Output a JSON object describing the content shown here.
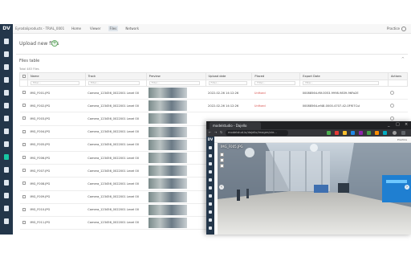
{
  "app": {
    "logo": "DV",
    "project": "Eyrodaliproducts - TRIAL_0001",
    "tabs": [
      "Home",
      "Viewer",
      "Files",
      "Network"
    ],
    "active_tab": "Files",
    "user": "Practice"
  },
  "upload": {
    "label": "Upload new files",
    "add_symbol": "+"
  },
  "files": {
    "title": "Files table",
    "collapse_symbol": "^",
    "count": "Total 483 Files",
    "columns": [
      "Name",
      "Track",
      "Preview",
      "Upload date",
      "Placed",
      "Export Date",
      "Actions"
    ],
    "filter_placeholder": "Filter...",
    "rows": [
      {
        "name": "IMG_F001.JPG",
        "track": "Camera_123456_0022001 Level 00",
        "upload": "2022-02-26 14:12:26",
        "placed": "Unfixed",
        "export": "00088564-f6f-0053-9998-9839-96Fa2E"
      },
      {
        "name": "IMG_F002.JPG",
        "track": "Camera_123456_0022001 Level 00",
        "upload": "2022-02-26 14:12:26",
        "placed": "Unfixed",
        "export": "00088564-ef48-0000-4707-42-0Ff07Cul"
      },
      {
        "name": "IMG_F003.JPG",
        "track": "Camera_123456_0022001 Level 00",
        "upload": "",
        "placed": "",
        "export": ""
      },
      {
        "name": "IMG_F004.JPG",
        "track": "Camera_123456_0022001 Level 00",
        "upload": "",
        "placed": "",
        "export": ""
      },
      {
        "name": "IMG_F005.JPG",
        "track": "Camera_123456_0022001 Level 00",
        "upload": "",
        "placed": "",
        "export": ""
      },
      {
        "name": "IMG_F006.JPG",
        "track": "Camera_123456_0022001 Level 00",
        "upload": "",
        "placed": "",
        "export": ""
      },
      {
        "name": "IMG_F007.JPG",
        "track": "Camera_123456_0022001 Level 00",
        "upload": "",
        "placed": "",
        "export": ""
      },
      {
        "name": "IMG_F008.JPG",
        "track": "Camera_123456_0022001 Level 00",
        "upload": "",
        "placed": "",
        "export": ""
      },
      {
        "name": "IMG_F009.JPG",
        "track": "Camera_123456_0022001 Level 00",
        "upload": "",
        "placed": "",
        "export": ""
      },
      {
        "name": "IMG_F010.JPG",
        "track": "Camera_123456_0022001 Level 00",
        "upload": "",
        "placed": "",
        "export": ""
      },
      {
        "name": "IMG_F011.JPG",
        "track": "Camera_123456_0022001 Level 00",
        "upload": "",
        "placed": "",
        "export": ""
      }
    ]
  },
  "preview_window": {
    "tab_title": "modelstudio - Dajello",
    "url": "modelstud.io/dajello/images/vie...",
    "image_title": "IMG_F005.JPG",
    "controls": [
      "_",
      "□",
      "×"
    ],
    "nav_prev": "‹",
    "nav_next": "›"
  },
  "colors": {
    "sidebar": "#23364a",
    "accent": "#18c6a3",
    "placed_unfixed": "#d9534f"
  }
}
